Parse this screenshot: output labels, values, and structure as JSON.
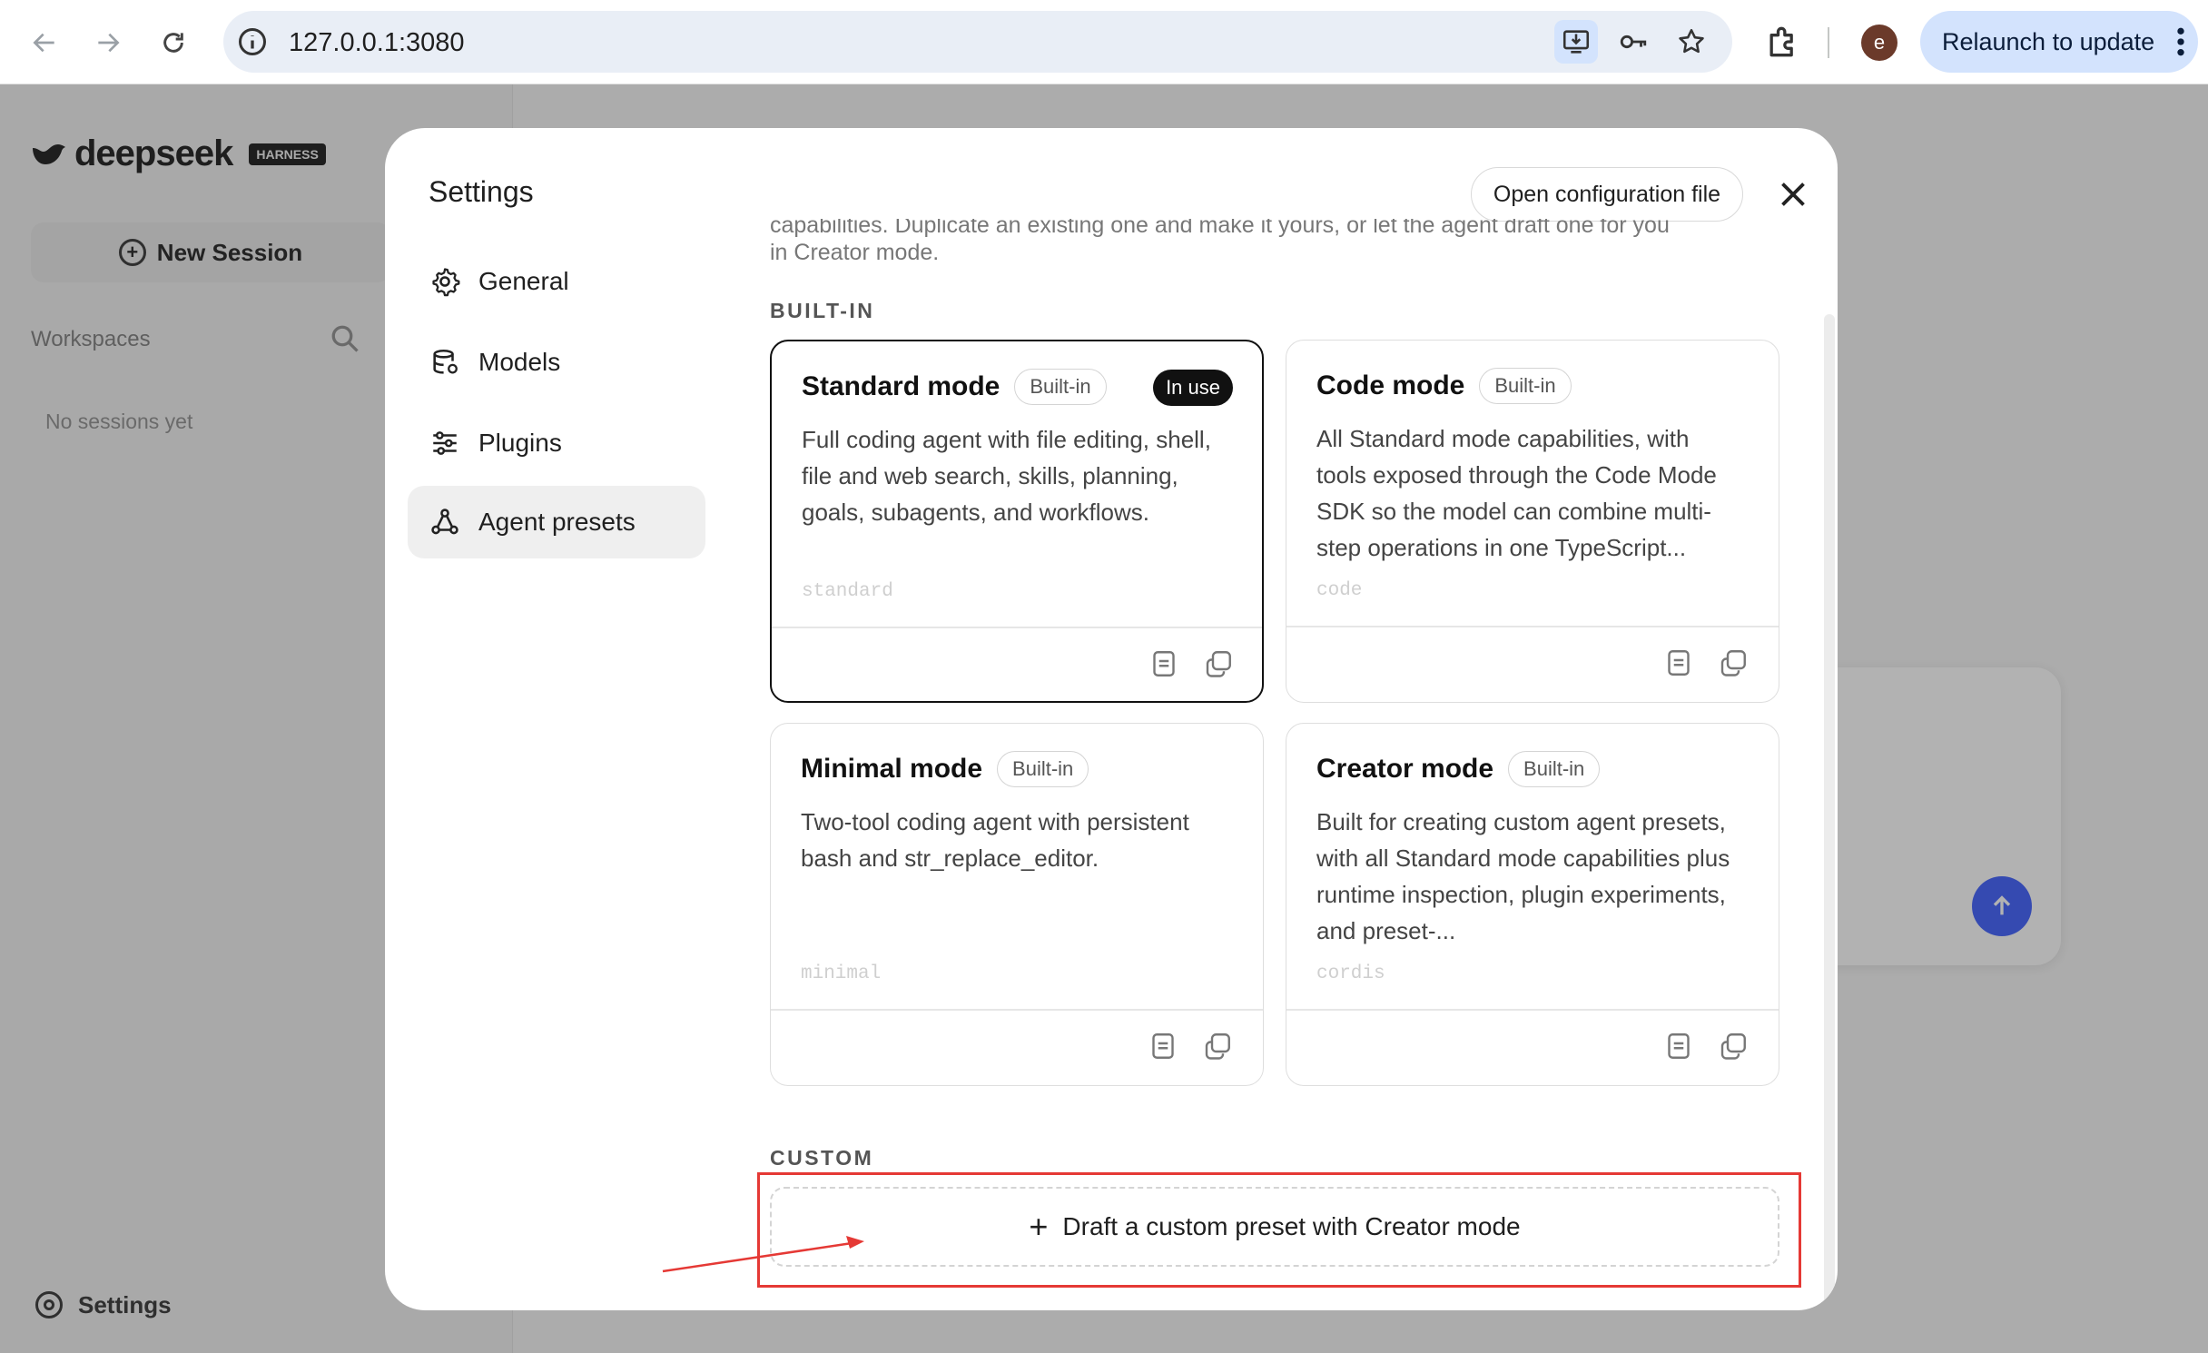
{
  "browser": {
    "url": "127.0.0.1:3080",
    "profile_initial": "e",
    "relaunch_label": "Relaunch to update"
  },
  "app": {
    "logo_text": "deepseek",
    "logo_badge": "HARNESS",
    "new_session_label": "New Session",
    "workspaces_label": "Workspaces",
    "no_sessions": "No sessions yet",
    "settings_label": "Settings"
  },
  "settings": {
    "title": "Settings",
    "open_config_label": "Open configuration file",
    "nav": [
      {
        "label": "General",
        "icon": "gear-icon"
      },
      {
        "label": "Models",
        "icon": "database-icon"
      },
      {
        "label": "Plugins",
        "icon": "sliders-icon"
      },
      {
        "label": "Agent presets",
        "icon": "presets-icon",
        "active": true
      }
    ],
    "intro_line1": "capabilities. Duplicate an existing one and make it yours, or let the agent draft one for you",
    "intro_line2": "in Creator mode.",
    "builtin_label": "BUILT-IN",
    "custom_label": "CUSTOM",
    "presets": [
      {
        "title": "Standard mode",
        "badge": "Built-in",
        "status": "In use",
        "description": "Full coding agent with file editing, shell, file and web search, skills, planning, goals, subagents, and workflows.",
        "id": "standard"
      },
      {
        "title": "Code mode",
        "badge": "Built-in",
        "description": "All Standard mode capabilities, with tools exposed through the Code Mode SDK so the model can combine multi-step operations in one TypeScript...",
        "id": "code"
      },
      {
        "title": "Minimal mode",
        "badge": "Built-in",
        "description": "Two-tool coding agent with persistent bash and str_replace_editor.",
        "id": "minimal"
      },
      {
        "title": "Creator mode",
        "badge": "Built-in",
        "description": "Built for creating custom agent presets, with all Standard mode capabilities plus runtime inspection, plugin experiments, and preset-...",
        "id": "cordis"
      }
    ],
    "draft_label": "Draft a custom preset with Creator mode"
  },
  "colors": {
    "annotation": "#e53935",
    "relaunch_bg": "#d3e3fd",
    "send_button": "#4d6bfe"
  }
}
